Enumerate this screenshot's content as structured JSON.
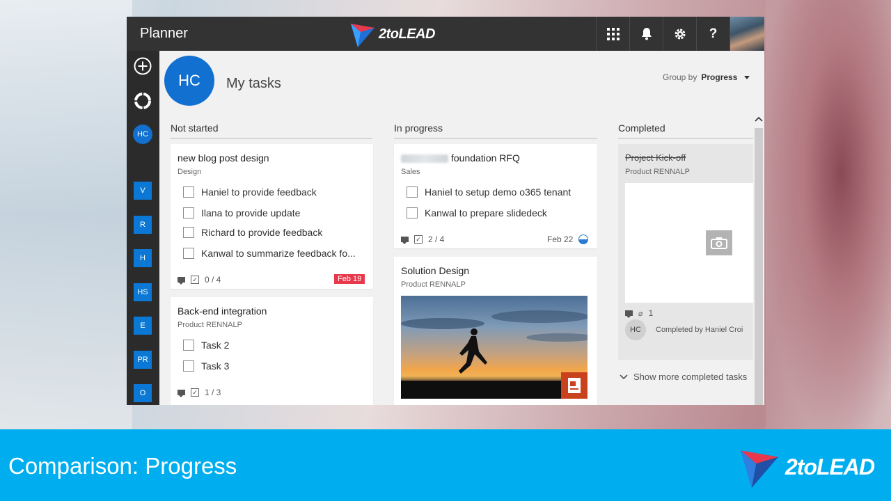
{
  "app": {
    "name": "Planner",
    "brand": "2toLEAD"
  },
  "topbar_icons": [
    "app-launcher-icon",
    "bell-icon",
    "gear-icon",
    "help-icon"
  ],
  "help_glyph": "?",
  "rail": {
    "squares": [
      "V",
      "R",
      "H",
      "HS",
      "E",
      "PR",
      "O"
    ],
    "current": "HC"
  },
  "header": {
    "avatar": "HC",
    "title": "My tasks",
    "group_by_label": "Group by",
    "group_by_value": "Progress"
  },
  "columns": {
    "not_started": "Not started",
    "in_progress": "In progress",
    "completed": "Completed"
  },
  "cards": {
    "blog": {
      "title": "new blog post design",
      "bucket": "Design",
      "items": [
        "Haniel to provide feedback",
        "Ilana to provide update",
        "Richard to provide feedback",
        "Kanwal to summarize feedback fo..."
      ],
      "progress": "0 / 4",
      "due": "Feb 19"
    },
    "backend": {
      "title": "Back-end integration",
      "bucket": "Product RENNALP",
      "items": [
        "Task 2",
        "Task 3"
      ],
      "progress": "1 / 3"
    },
    "rfq": {
      "title": "foundation RFQ",
      "bucket": "Sales",
      "items": [
        "Haniel to setup demo o365 tenant",
        "Kanwal to prepare slidedeck"
      ],
      "progress": "2 / 4",
      "due": "Feb 22"
    },
    "solution": {
      "title": "Solution Design",
      "bucket": "Product RENNALP"
    },
    "kickoff": {
      "title": "Project Kick-off",
      "bucket": "Product RENNALP",
      "attachments": "1",
      "avatar": "HC",
      "completed_by": "Completed by Haniel Croi"
    }
  },
  "show_more": "Show more completed tasks",
  "banner": {
    "title": "Comparison:  Progress",
    "brand": "2toLEAD"
  },
  "colors": {
    "accent": "#0a78d4",
    "banner": "#00aeef",
    "overdue": "#e8384b",
    "topbar": "#333333"
  }
}
